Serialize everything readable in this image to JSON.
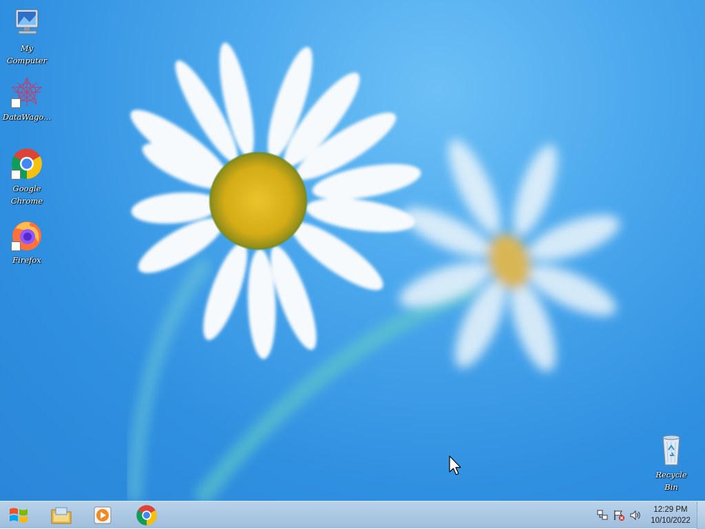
{
  "desktop": {
    "icons": [
      {
        "label": "My\nComputer",
        "icon": "my-computer-icon"
      },
      {
        "label": "DataWago...",
        "icon": "datawago-icon",
        "shortcut": true
      },
      {
        "label": "Google\nChrome",
        "icon": "chrome-icon",
        "shortcut": true
      },
      {
        "label": "Firefox",
        "icon": "firefox-icon",
        "shortcut": true
      }
    ],
    "recycle_bin": {
      "label": "Recycle\nBin",
      "icon": "recycle-bin-icon"
    }
  },
  "taskbar": {
    "start": {
      "icon": "windows-logo-icon"
    },
    "pinned": [
      {
        "name": "file-explorer",
        "icon": "file-explorer-icon"
      },
      {
        "name": "windows-media-player",
        "icon": "media-player-icon"
      },
      {
        "name": "google-chrome",
        "icon": "chrome-icon"
      }
    ],
    "tray": {
      "icons": [
        "network-icon",
        "action-center-flag-icon",
        "volume-icon"
      ],
      "time": "12:29 PM",
      "date": "10/10/2022"
    }
  },
  "colors": {
    "wallpaper": "#3a99e6",
    "taskbar": "#aac6e2",
    "chrome_red": "#db4437",
    "chrome_yellow": "#f4c20d",
    "chrome_green": "#0f9d58",
    "chrome_blue": "#4285f4"
  }
}
